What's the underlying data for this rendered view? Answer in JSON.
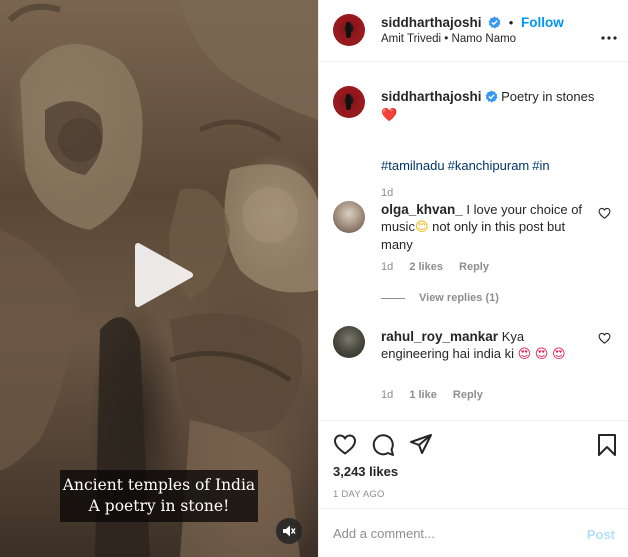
{
  "media": {
    "caption_line1": "Ancient temples of India",
    "caption_line2": "A poetry in stone!",
    "icons": {
      "play": "play-icon",
      "mute": "speaker-muted-icon"
    }
  },
  "header": {
    "username": "siddharthajoshi",
    "separator": "•",
    "follow_label": "Follow",
    "audio_artist": "Amit Trivedi",
    "audio_sep": "•",
    "audio_track": "Namo Namo",
    "icons": {
      "verified": "verified-badge-icon",
      "more": "more-options-icon"
    }
  },
  "caption": {
    "username": "siddharthajoshi",
    "text": "Poetry in stones",
    "emoji": "❤️",
    "hashtags": [
      "#tamilnadu",
      "#kanchipuram",
      "#in"
    ],
    "time": "1d"
  },
  "comments": [
    {
      "username": "olga_khvan_",
      "text_part1": "I love your choice of music",
      "emoji1": "😊",
      "text_part2": "not only in this post but many",
      "time": "1d",
      "likes": "2 likes",
      "reply_label": "Reply",
      "view_replies": "View replies (1)"
    },
    {
      "username": "rahul_roy_mankar",
      "text_part1": "Kya engineering hai india ki",
      "emoji1": "😍",
      "emoji2": "😍",
      "emoji3": "😍",
      "time": "1d",
      "likes": "1 like",
      "reply_label": "Reply"
    }
  ],
  "actions": {
    "icons": [
      "heart-icon",
      "comment-icon",
      "share-icon",
      "bookmark-icon"
    ],
    "likes_count": "3,243 likes",
    "posted_ago": "1 DAY AGO"
  },
  "composer": {
    "placeholder": "Add a comment...",
    "post_label": "Post"
  },
  "colors": {
    "accent": "#0095f6",
    "hashtag": "#00376b",
    "muted": "#8e8e8e",
    "post_disabled": "#b2dffc",
    "heart": "#ed4956"
  }
}
